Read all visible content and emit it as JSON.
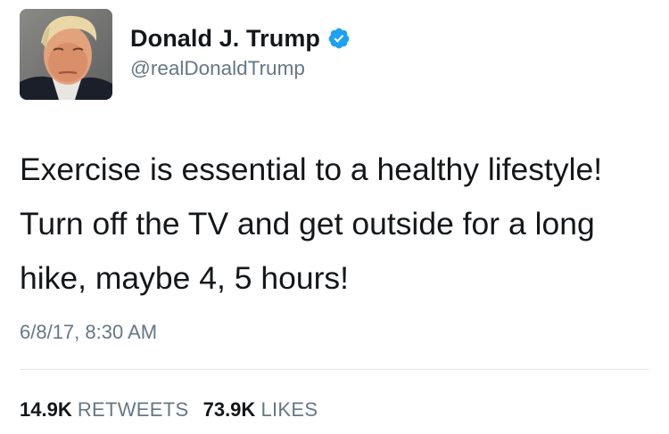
{
  "author": {
    "display_name": "Donald J. Trump",
    "handle": "@realDonaldTrump",
    "verified": true,
    "verified_color": "#1da1f2"
  },
  "tweet": {
    "text": "Exercise is essential to a healthy lifestyle! Turn off the TV and get outside for a long hike, maybe 4, 5 hours!",
    "timestamp": "6/8/17, 8:30 AM"
  },
  "stats": {
    "retweets_count": "14.9K",
    "retweets_label": "RETWEETS",
    "likes_count": "73.9K",
    "likes_label": "LIKES"
  },
  "colors": {
    "text": "#14171a",
    "secondary": "#657786",
    "divider": "#e1e8ed"
  }
}
